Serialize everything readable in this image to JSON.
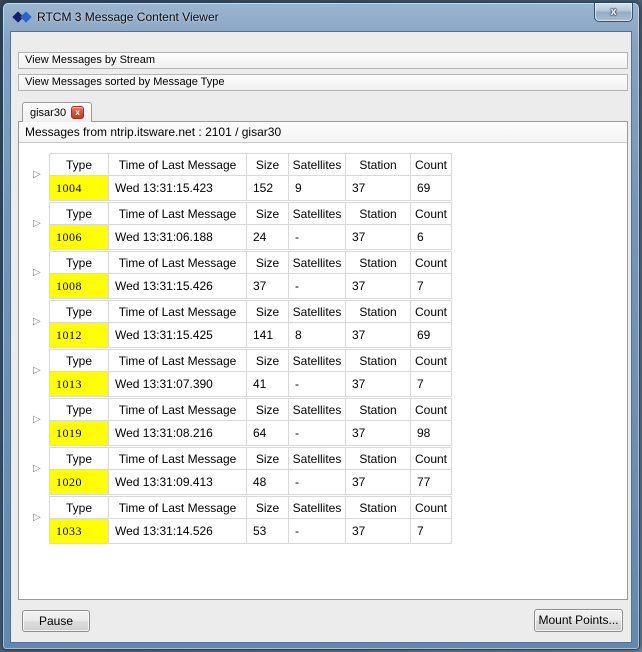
{
  "window": {
    "title": "RTCM 3 Message Content Viewer",
    "close_glyph": "x"
  },
  "stream_panels": [
    {
      "label": "View Messages by Stream"
    },
    {
      "label": "View Messages sorted by Message Type"
    }
  ],
  "tab": {
    "label": "gisar30",
    "close_glyph": "x"
  },
  "messages_header": "Messages from ntrip.itsware.net : 2101 / gisar30",
  "message_table": {
    "columns": [
      "Type",
      "Time of Last Message",
      "Size",
      "Satellites",
      "Station",
      "Count"
    ],
    "rows": [
      [
        "1004",
        "Wed 13:31:15.423",
        "152",
        "9",
        "37",
        "69"
      ],
      [
        "1006",
        "Wed 13:31:06.188",
        "24",
        "-",
        "37",
        "6"
      ],
      [
        "1008",
        "Wed 13:31:15.426",
        "37",
        "-",
        "37",
        "7"
      ],
      [
        "1012",
        "Wed 13:31:15.425",
        "141",
        "8",
        "37",
        "69"
      ],
      [
        "1013",
        "Wed 13:31:07.390",
        "41",
        "-",
        "37",
        "7"
      ],
      [
        "1019",
        "Wed 13:31:08.216",
        "64",
        "-",
        "37",
        "98"
      ],
      [
        "1020",
        "Wed 13:31:09.413",
        "48",
        "-",
        "37",
        "77"
      ],
      [
        "1033",
        "Wed 13:31:14.526",
        "53",
        "-",
        "37",
        "7"
      ]
    ],
    "expander_glyph": "▷"
  },
  "footer": {
    "pause_button": "Pause",
    "mount_points_button": "Mount Points..."
  },
  "colors": {
    "type_highlight": "#ffff00",
    "tab_close_red": "#c63b26",
    "titlebar_blue": "#7397bb"
  }
}
